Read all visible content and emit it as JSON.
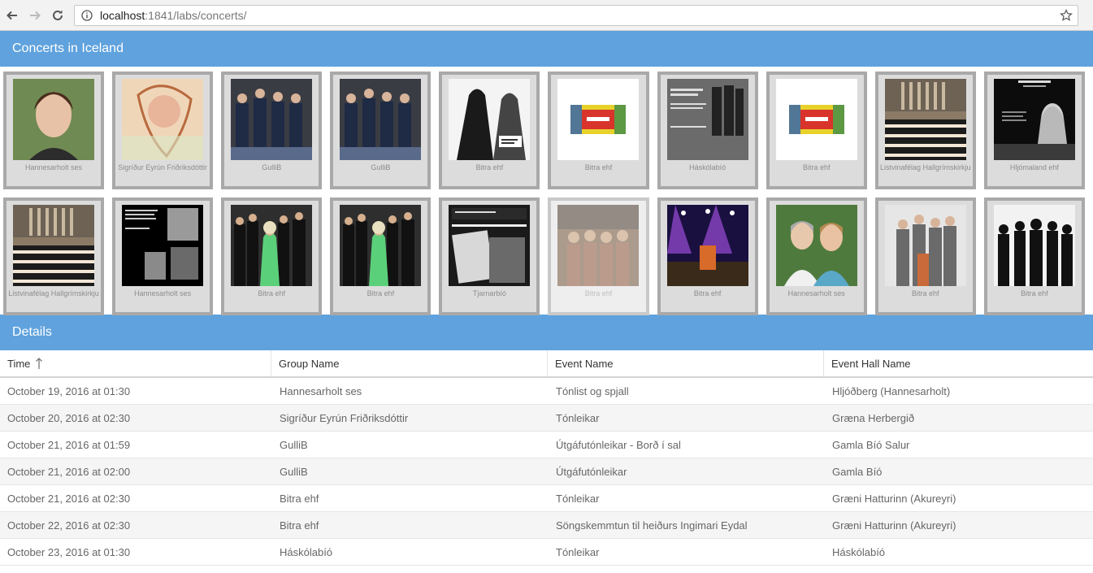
{
  "browser": {
    "url_host": "localhost",
    "url_rest": ":1841/labs/concerts/"
  },
  "header": {
    "title": "Concerts in Iceland"
  },
  "gallery": {
    "rows": [
      [
        {
          "caption": "Hannesarholt ses",
          "icon": "portrait-photo"
        },
        {
          "caption": "Sigríður Eyrún Friðriksdóttir",
          "icon": "portrait-art"
        },
        {
          "caption": "GulliB",
          "icon": "band-photo"
        },
        {
          "caption": "GulliB",
          "icon": "band-photo"
        },
        {
          "caption": "Bitra ehf",
          "icon": "bw-duo-photo"
        },
        {
          "caption": "Bitra ehf",
          "icon": "logo-banner"
        },
        {
          "caption": "Háskólabíó",
          "icon": "poster-dark"
        },
        {
          "caption": "Bitra ehf",
          "icon": "logo-banner"
        },
        {
          "caption": "Listvinafélag Hallgrímskirkju",
          "icon": "choir-photo"
        },
        {
          "caption": "Hljómaland ehf",
          "icon": "poster-black"
        }
      ],
      [
        {
          "caption": "Listvinafélag Hallgrímskirkju",
          "icon": "choir-photo"
        },
        {
          "caption": "Hannesarholt ses",
          "icon": "collage-black"
        },
        {
          "caption": "Bitra ehf",
          "icon": "band-dark-photo"
        },
        {
          "caption": "Bitra ehf",
          "icon": "band-dark-photo"
        },
        {
          "caption": "Tjarnarbíó",
          "icon": "film-poster"
        },
        {
          "caption": "Bitra ehf",
          "icon": "group-photo",
          "faded": true
        },
        {
          "caption": "Bitra ehf",
          "icon": "stage-lights-photo"
        },
        {
          "caption": "Hannesarholt ses",
          "icon": "duo-photo"
        },
        {
          "caption": "Bitra ehf",
          "icon": "group-light-photo"
        },
        {
          "caption": "Bitra ehf",
          "icon": "silhouettes"
        }
      ]
    ]
  },
  "details": {
    "title": "Details",
    "columns": [
      "Time",
      "Group Name",
      "Event Name",
      "Event Hall Name"
    ],
    "sort_icon": "sort-ascending-icon",
    "rows": [
      [
        "October 19, 2016 at 01:30",
        "Hannesarholt ses",
        "Tónlist og spjall",
        "Hljóðberg (Hannesarholt)"
      ],
      [
        "October 20, 2016 at 02:30",
        "Sigríður Eyrún Friðriksdóttir",
        "Tónleikar",
        "Græna Herbergið"
      ],
      [
        "October 21, 2016 at 01:59",
        "GulliB",
        "Útgáfutónleikar - Borð í sal",
        "Gamla Bíó Salur"
      ],
      [
        "October 21, 2016 at 02:00",
        "GulliB",
        "Útgáfutónleikar",
        "Gamla Bíó"
      ],
      [
        "October 21, 2016 at 02:30",
        "Bitra ehf",
        "Tónleikar",
        "Græni Hatturinn (Akureyri)"
      ],
      [
        "October 22, 2016 at 02:30",
        "Bitra ehf",
        "Söngskemmtun til heiðurs Ingimari Eydal",
        "Græni Hatturinn (Akureyri)"
      ],
      [
        "October 23, 2016 at 01:30",
        "Háskólabíó",
        "Tónleikar",
        "Háskólabíó"
      ]
    ]
  },
  "colors": {
    "header_bg": "#5fa2dd",
    "tile_border": "#a9a9a9",
    "tile_bg": "#dcdcdc"
  }
}
